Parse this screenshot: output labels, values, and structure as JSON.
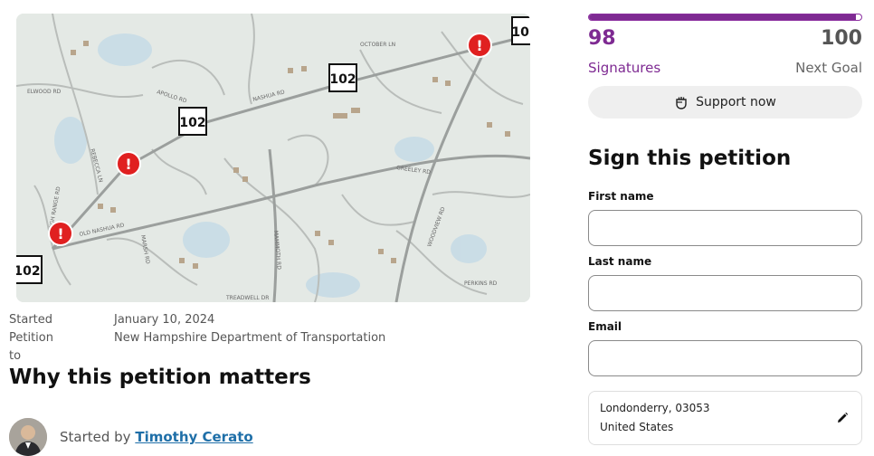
{
  "map": {
    "route_label": "102",
    "road_labels": [
      "NASHUA RD",
      "APOLLO RD",
      "ELWOOD RD",
      "OLD NASHUA RD",
      "GREELEY RD",
      "PERKINS RD",
      "OCTOBER LN",
      "HIGH RANGE RD",
      "MAMMOTH RD",
      "REBECCA LN",
      "MARSH RD",
      "TREADWELL DR",
      "WOODVIEW RD"
    ],
    "marker_glyph": "!"
  },
  "meta": {
    "started_label": "Started",
    "started_value": "January 10, 2024",
    "petition_to_label": "Petition to",
    "petition_to_value": "New Hampshire Department of Transportation"
  },
  "why_title": "Why this petition matters",
  "author": {
    "prefix": "Started by",
    "name": "Timothy Cerato"
  },
  "progress": {
    "signatures": "98",
    "signatures_label": "Signatures",
    "goal": "100",
    "goal_label": "Next Goal",
    "fraction": 0.98
  },
  "support_button": {
    "label": "Support now",
    "icon": "fist-icon"
  },
  "form": {
    "title": "Sign this petition",
    "first_name_label": "First name",
    "first_name_value": "",
    "last_name_label": "Last name",
    "last_name_value": "",
    "email_label": "Email",
    "email_value": ""
  },
  "location": {
    "line1": "Londonderry, 03053",
    "line2": "United States",
    "edit_icon": "pencil-icon"
  },
  "colors": {
    "brand_purple": "#7e2a92",
    "marker_red": "#e02020",
    "link_blue": "#1f6fa8"
  }
}
